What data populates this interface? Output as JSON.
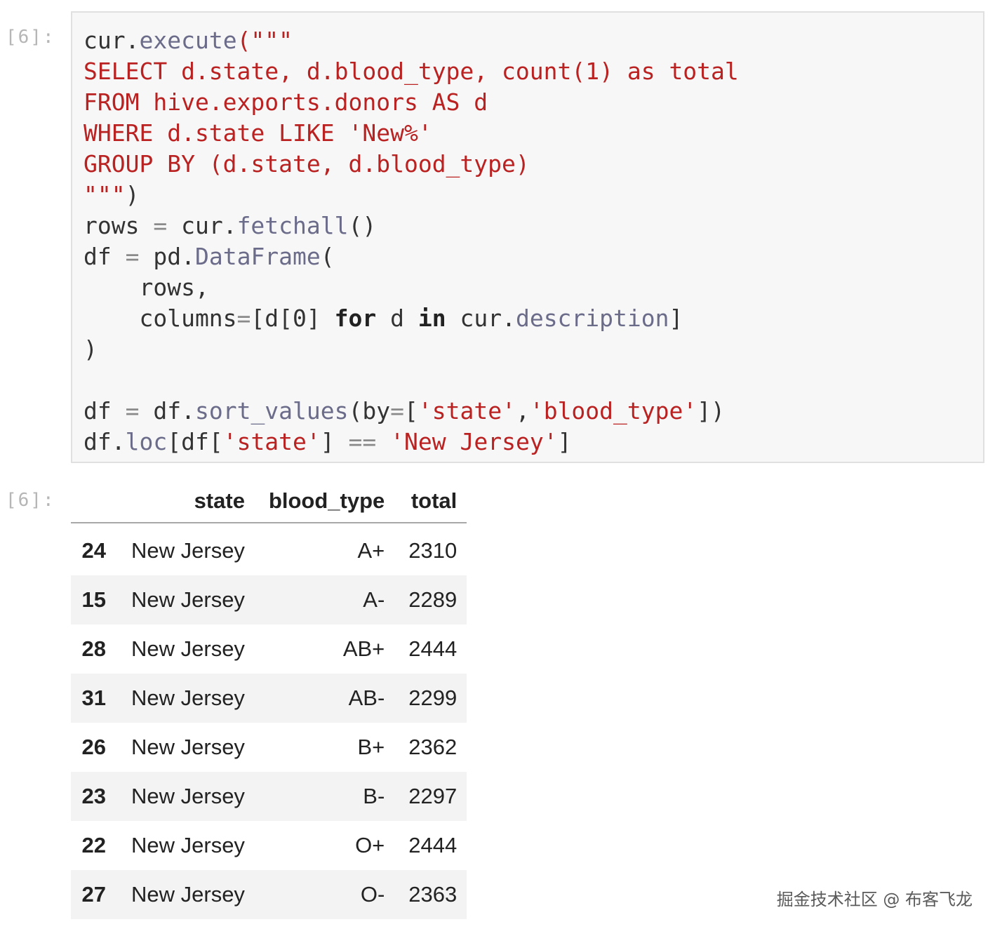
{
  "input_prompt": "[6]:",
  "output_prompt": "[6]:",
  "code_lines": [
    [
      {
        "t": "cur.",
        "c": "p"
      },
      {
        "t": "execute",
        "c": "attr"
      },
      {
        "t": "(\"\"\"",
        "c": "str"
      }
    ],
    [
      {
        "t": "SELECT d.state, d.blood_type, count(1) as total",
        "c": "str"
      }
    ],
    [
      {
        "t": "FROM hive.exports.donors AS d",
        "c": "str"
      }
    ],
    [
      {
        "t": "WHERE d.state LIKE 'New%'",
        "c": "str"
      }
    ],
    [
      {
        "t": "GROUP BY (d.state, d.blood_type)",
        "c": "str"
      }
    ],
    [
      {
        "t": "\"\"\"",
        "c": "str"
      },
      {
        "t": ")",
        "c": "p"
      }
    ],
    [
      {
        "t": "rows ",
        "c": "p"
      },
      {
        "t": "=",
        "c": "op"
      },
      {
        "t": " cur.",
        "c": "p"
      },
      {
        "t": "fetchall",
        "c": "attr"
      },
      {
        "t": "()",
        "c": "p"
      }
    ],
    [
      {
        "t": "df ",
        "c": "p"
      },
      {
        "t": "=",
        "c": "op"
      },
      {
        "t": " pd.",
        "c": "p"
      },
      {
        "t": "DataFrame",
        "c": "attr"
      },
      {
        "t": "(",
        "c": "p"
      }
    ],
    [
      {
        "t": "    rows,",
        "c": "p"
      }
    ],
    [
      {
        "t": "    columns",
        "c": "p"
      },
      {
        "t": "=",
        "c": "op"
      },
      {
        "t": "[d[0] ",
        "c": "p"
      },
      {
        "t": "for",
        "c": "kw"
      },
      {
        "t": " d ",
        "c": "p"
      },
      {
        "t": "in",
        "c": "kw"
      },
      {
        "t": " cur.",
        "c": "p"
      },
      {
        "t": "description",
        "c": "attr"
      },
      {
        "t": "]",
        "c": "p"
      }
    ],
    [
      {
        "t": ")",
        "c": "p"
      }
    ],
    [
      {
        "t": "",
        "c": "p"
      }
    ],
    [
      {
        "t": "df ",
        "c": "p"
      },
      {
        "t": "=",
        "c": "op"
      },
      {
        "t": " df.",
        "c": "p"
      },
      {
        "t": "sort_values",
        "c": "attr"
      },
      {
        "t": "(by",
        "c": "p"
      },
      {
        "t": "=",
        "c": "op"
      },
      {
        "t": "[",
        "c": "p"
      },
      {
        "t": "'state'",
        "c": "str"
      },
      {
        "t": ",",
        "c": "p"
      },
      {
        "t": "'blood_type'",
        "c": "str"
      },
      {
        "t": "])",
        "c": "p"
      }
    ],
    [
      {
        "t": "df.",
        "c": "p"
      },
      {
        "t": "loc",
        "c": "attr"
      },
      {
        "t": "[df[",
        "c": "p"
      },
      {
        "t": "'state'",
        "c": "str"
      },
      {
        "t": "] ",
        "c": "p"
      },
      {
        "t": "==",
        "c": "op"
      },
      {
        "t": " ",
        "c": "p"
      },
      {
        "t": "'New Jersey'",
        "c": "str"
      },
      {
        "t": "]",
        "c": "p"
      }
    ]
  ],
  "table": {
    "columns": [
      "state",
      "blood_type",
      "total"
    ],
    "rows": [
      {
        "index": "24",
        "state": "New Jersey",
        "blood_type": "A+",
        "total": "2310"
      },
      {
        "index": "15",
        "state": "New Jersey",
        "blood_type": "A-",
        "total": "2289"
      },
      {
        "index": "28",
        "state": "New Jersey",
        "blood_type": "AB+",
        "total": "2444"
      },
      {
        "index": "31",
        "state": "New Jersey",
        "blood_type": "AB-",
        "total": "2299"
      },
      {
        "index": "26",
        "state": "New Jersey",
        "blood_type": "B+",
        "total": "2362"
      },
      {
        "index": "23",
        "state": "New Jersey",
        "blood_type": "B-",
        "total": "2297"
      },
      {
        "index": "22",
        "state": "New Jersey",
        "blood_type": "O+",
        "total": "2444"
      },
      {
        "index": "27",
        "state": "New Jersey",
        "blood_type": "O-",
        "total": "2363"
      }
    ]
  },
  "watermark": "掘金技术社区 @ 布客飞龙"
}
